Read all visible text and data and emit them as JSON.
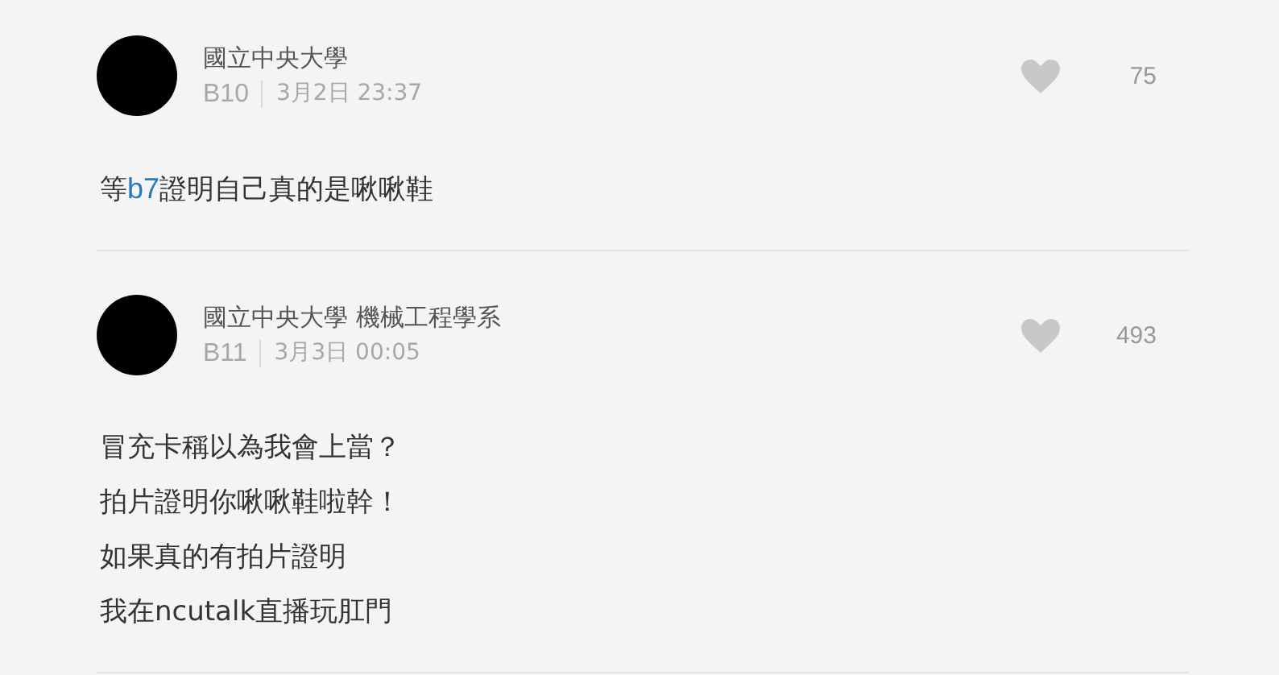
{
  "comments": [
    {
      "author": "國立中央大學",
      "floor": "B10",
      "time": "3月2日 23:37",
      "likes": "75",
      "lines": [
        [
          {
            "kind": "text",
            "text": "等"
          },
          {
            "kind": "link",
            "text": "b7"
          },
          {
            "kind": "text",
            "text": "證明自己真的是啾啾鞋"
          }
        ]
      ]
    },
    {
      "author": "國立中央大學 機械工程學系",
      "floor": "B11",
      "time": "3月3日 00:05",
      "likes": "493",
      "lines": [
        [
          {
            "kind": "text",
            "text": "冒充卡稱以為我會上當？"
          }
        ],
        [
          {
            "kind": "text",
            "text": "拍片證明你啾啾鞋啦幹！"
          }
        ],
        [
          {
            "kind": "text",
            "text": "如果真的有拍片證明"
          }
        ],
        [
          {
            "kind": "text",
            "text": "我在ncutalk直播玩肛門"
          }
        ]
      ]
    }
  ]
}
